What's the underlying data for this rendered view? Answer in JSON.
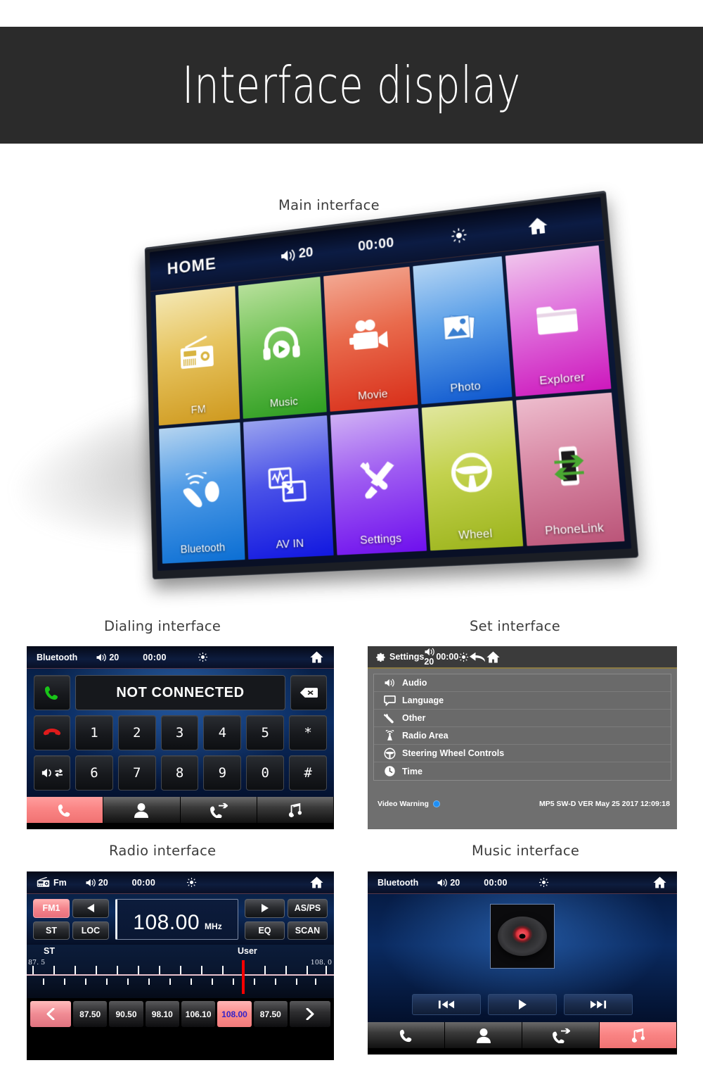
{
  "banner": {
    "title": "Interface display"
  },
  "sections": {
    "main": "Main interface",
    "dialing": "Dialing interface",
    "set": "Set interface",
    "radio": "Radio interface",
    "music": "Music interface"
  },
  "main_interface": {
    "status": {
      "title": "HOME",
      "volume": "20",
      "clock": "00:00",
      "brightness_icon": "brightness-icon",
      "home_icon": "home-icon",
      "volume_icon": "volume-icon"
    },
    "tiles": [
      {
        "label": "FM",
        "icon": "radio-icon",
        "c1": "#f2e3a8",
        "c2": "#d9a531"
      },
      {
        "label": "Music",
        "icon": "headphones-icon",
        "c1": "#a9d98a",
        "c2": "#3fa92e"
      },
      {
        "label": "Movie",
        "icon": "video-camera-icon",
        "c1": "#ef9b84",
        "c2": "#e0391c"
      },
      {
        "label": "Photo",
        "icon": "photo-icon",
        "c1": "#a8cdf0",
        "c2": "#1565d8"
      },
      {
        "label": "Explorer",
        "icon": "folder-icon",
        "c1": "#eec0ea",
        "c2": "#d521c4"
      },
      {
        "label": "Bluetooth",
        "icon": "phone-signal-icon",
        "c1": "#a8cbeb",
        "c2": "#1a7fe0"
      },
      {
        "label": "AV IN",
        "icon": "av-in-icon",
        "c1": "#8b95ec",
        "c2": "#1622e8"
      },
      {
        "label": "Settings",
        "icon": "tools-icon",
        "c1": "#c5a2f0",
        "c2": "#7a20f0"
      },
      {
        "label": "Wheel",
        "icon": "steering-wheel-icon",
        "c1": "#d8e08a",
        "c2": "#a6bb23"
      },
      {
        "label": "PhoneLink",
        "icon": "phonelink-icon",
        "c1": "#e6aec2",
        "c2": "#c45f84"
      }
    ]
  },
  "dialing_interface": {
    "status": {
      "title": "Bluetooth",
      "volume": "20",
      "clock": "00:00"
    },
    "display_value": "NOT CONNECTED",
    "backspace_icon": "backspace-icon",
    "call_icon": "call-answer-icon",
    "hangup_icon": "call-end-icon",
    "transfer_icon": "audio-transfer-icon",
    "keys_row1": [
      "1",
      "2",
      "3",
      "4",
      "5",
      "*"
    ],
    "keys_row2": [
      "6",
      "7",
      "8",
      "9",
      "0",
      "#"
    ],
    "navbar": [
      {
        "icon": "phone-icon",
        "active": true
      },
      {
        "icon": "contacts-icon",
        "active": false
      },
      {
        "icon": "call-history-icon",
        "active": false
      },
      {
        "icon": "music-note-icon",
        "active": false
      }
    ]
  },
  "set_interface": {
    "status": {
      "title": "Settings",
      "volume": "20",
      "clock": "00:00",
      "gear_icon": "gear-icon",
      "back_icon": "back-arrow-icon",
      "home_icon": "home-icon"
    },
    "items": [
      {
        "label": "Audio",
        "icon": "volume-icon"
      },
      {
        "label": "Language",
        "icon": "speech-bubble-icon"
      },
      {
        "label": "Other",
        "icon": "wrench-icon"
      },
      {
        "label": "Radio Area",
        "icon": "antenna-icon"
      },
      {
        "label": "Steering Wheel Controls",
        "icon": "steering-wheel-icon"
      },
      {
        "label": "Time",
        "icon": "clock-icon"
      }
    ],
    "footer": {
      "video_warning_label": "Video Warning",
      "version": "MP5 SW-D VER May 25 2017 12:09:18"
    }
  },
  "radio_interface": {
    "status": {
      "title": "Fm",
      "volume": "20",
      "clock": "00:00",
      "radio_icon": "radio-icon"
    },
    "band_button": "FM1",
    "prev_icon": "prev-arrow-icon",
    "next_icon": "next-arrow-icon",
    "st_button": "ST",
    "loc_button": "LOC",
    "asps_button": "AS/PS",
    "eq_button": "EQ",
    "scan_button": "SCAN",
    "frequency": "108.00",
    "unit": "MHz",
    "scale": {
      "left_label": "ST",
      "right_label": "User",
      "min": "87. 5",
      "max": "108. 0",
      "needle_pct": 70
    },
    "presets": [
      "87.50",
      "90.50",
      "98.10",
      "106.10",
      "108.00",
      "87.50"
    ],
    "selected_preset_index": 4,
    "prev_page_icon": "chevron-left-icon",
    "next_page_icon": "chevron-right-icon"
  },
  "music_interface": {
    "status": {
      "title": "Bluetooth",
      "volume": "20",
      "clock": "00:00"
    },
    "album_art": "vinyl-record-icon",
    "controls": [
      {
        "icon": "previous-track-icon"
      },
      {
        "icon": "play-icon"
      },
      {
        "icon": "next-track-icon"
      }
    ],
    "navbar": [
      {
        "icon": "phone-icon",
        "active": false
      },
      {
        "icon": "contacts-icon",
        "active": false
      },
      {
        "icon": "call-history-icon",
        "active": false
      },
      {
        "icon": "music-note-icon",
        "active": true
      }
    ]
  },
  "colors": {
    "banner_bg": "#2b2b2b",
    "accent_pink": "#f58787",
    "settings_bg": "#6f6f6f",
    "needle_red": "#f50000"
  }
}
